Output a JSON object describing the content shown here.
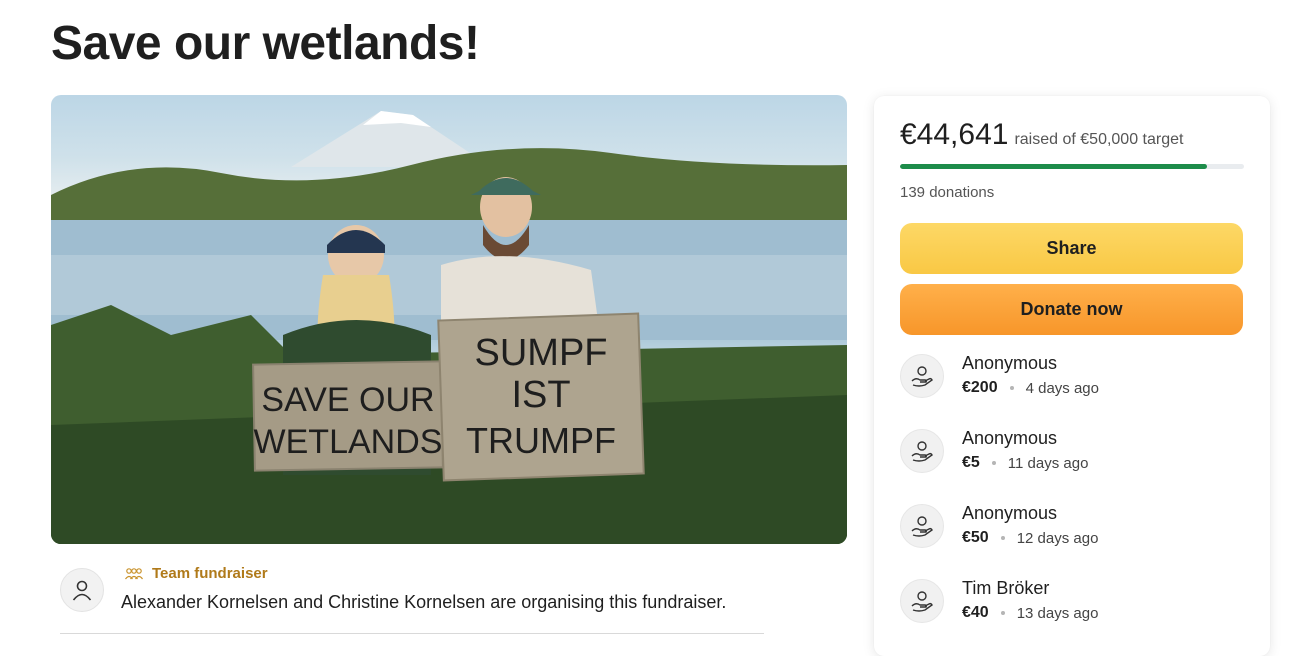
{
  "page": {
    "title": "Save our wetlands!"
  },
  "hero": {
    "sign_left": [
      "SAVE OUR",
      "WETLANDS"
    ],
    "sign_right": [
      "SUMPF",
      "IST",
      "TRUMPF"
    ]
  },
  "organiser": {
    "badge_icon": "team-people-icon",
    "team_label": "Team fundraiser",
    "text": "Alexander Kornelsen and Christine Kornelsen are organising this fundraiser."
  },
  "summary": {
    "raised": "€44,641",
    "target_text": "raised of €50,000 target",
    "progress_fraction": 0.893,
    "donations": "139 donations",
    "accent_color": "#1d8c4a"
  },
  "buttons": {
    "share": "Share",
    "donate": "Donate now"
  },
  "donations": [
    {
      "name": "Anonymous",
      "amount": "€200",
      "time": "4 days ago",
      "icon": "donation-hand-icon"
    },
    {
      "name": "Anonymous",
      "amount": "€5",
      "time": "11 days ago",
      "icon": "donation-hand-icon"
    },
    {
      "name": "Anonymous",
      "amount": "€50",
      "time": "12 days ago",
      "icon": "donation-hand-icon"
    },
    {
      "name": "Tim Bröker",
      "amount": "€40",
      "time": "13 days ago",
      "icon": "donation-hand-icon"
    }
  ]
}
